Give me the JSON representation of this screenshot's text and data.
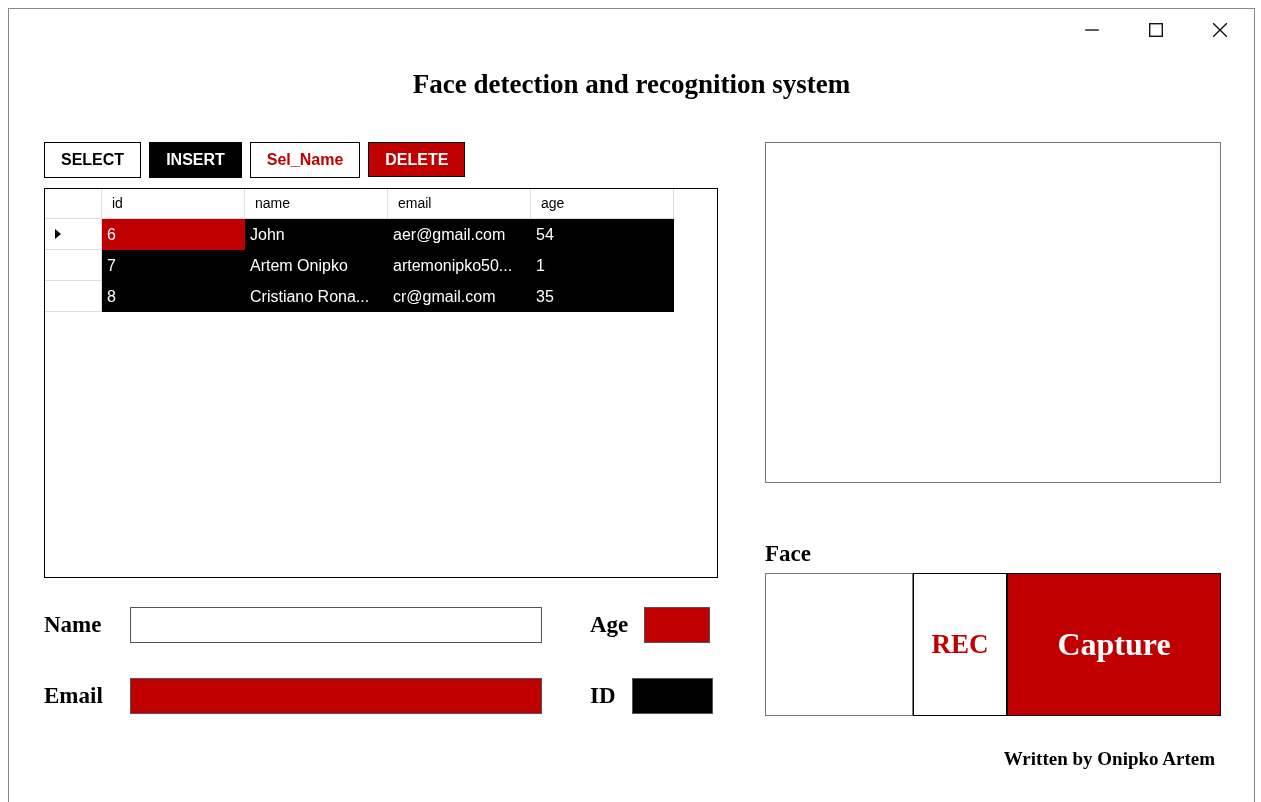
{
  "window": {
    "title": "Face detection and recognition system"
  },
  "toolbar": [
    {
      "label": "SELECT",
      "kind": "outline"
    },
    {
      "label": "INSERT",
      "kind": "dark"
    },
    {
      "label": "Sel_Name",
      "kind": "redtext"
    },
    {
      "label": "DELETE",
      "kind": "red"
    }
  ],
  "table": {
    "columns": [
      "id",
      "name",
      "email",
      "age"
    ],
    "rows": [
      {
        "cells": [
          "6",
          "John",
          "aer@gmail.com",
          "54"
        ],
        "selected": true,
        "current": true
      },
      {
        "cells": [
          "7",
          "Artem Onipko",
          "artemonipko50...",
          "1"
        ],
        "selected": true,
        "current": false
      },
      {
        "cells": [
          "8",
          "Cristiano Rona...",
          "cr@gmail.com",
          "35"
        ],
        "selected": true,
        "current": false
      }
    ]
  },
  "form": {
    "name_label": "Name",
    "email_label": "Email",
    "age_label": "Age",
    "id_label": "ID"
  },
  "face": {
    "label": "Face",
    "rec_button": "REC",
    "capture_button": "Capture"
  },
  "footer": "Written by Onipko Artem"
}
